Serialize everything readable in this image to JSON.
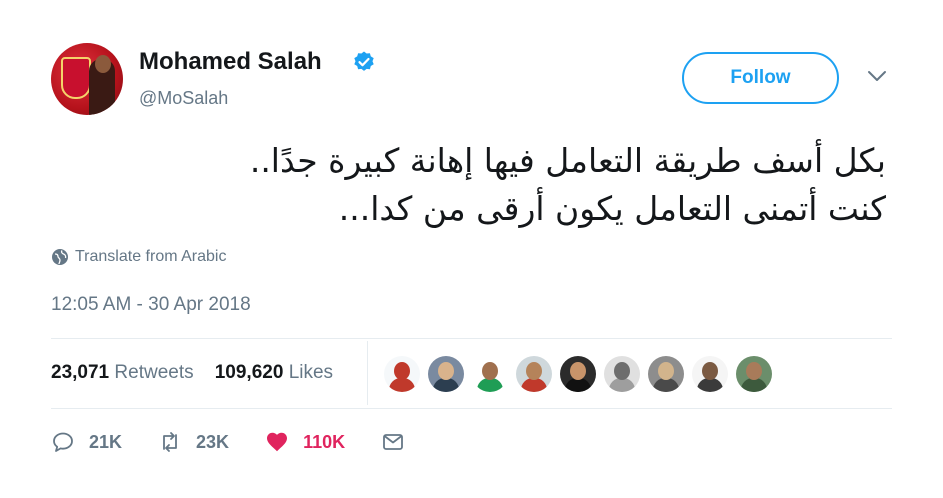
{
  "user": {
    "display_name": "Mohamed Salah",
    "handle": "@MoSalah",
    "verified": true,
    "avatar_icon": "liverpool-avatar"
  },
  "follow_label": "Follow",
  "tweet": {
    "lines": [
      "بكل أسف طريقة التعامل فيها إهانة كبيرة جدًا..",
      "كنت أتمنى التعامل يكون أرقى من كدا..."
    ],
    "translate_label": "Translate from Arabic",
    "timestamp": "12:05 AM - 30 Apr 2018"
  },
  "stats": {
    "retweets_count": "23,071",
    "retweets_label": "Retweets",
    "likes_count": "109,620",
    "likes_label": "Likes"
  },
  "likers": [
    {
      "icon": "liker-avatar-1",
      "bg": "#f5f8fa",
      "face": "#c0392b",
      "body": "#c0392b"
    },
    {
      "icon": "liker-avatar-2",
      "bg": "#7a8aa0",
      "face": "#d9b38c",
      "body": "#2c3e50"
    },
    {
      "icon": "liker-avatar-3",
      "bg": "#ffffff",
      "face": "#a0704e",
      "body": "#1f9d55"
    },
    {
      "icon": "liker-avatar-4",
      "bg": "#cfd8dc",
      "face": "#b5835a",
      "body": "#c0392b"
    },
    {
      "icon": "liker-avatar-5",
      "bg": "#2b2b2b",
      "face": "#c8946a",
      "body": "#111111"
    },
    {
      "icon": "liker-avatar-6",
      "bg": "#e0e0e0",
      "face": "#6d6d6d",
      "body": "#9e9e9e"
    },
    {
      "icon": "liker-avatar-7",
      "bg": "#8d8d8d",
      "face": "#d2b48c",
      "body": "#4a4a4a"
    },
    {
      "icon": "liker-avatar-8",
      "bg": "#f5f5f5",
      "face": "#7b5a42",
      "body": "#3b3b3b"
    },
    {
      "icon": "liker-avatar-9",
      "bg": "#6b8e6b",
      "face": "#a87b5a",
      "body": "#3d5a3d"
    }
  ],
  "actions": {
    "reply_count": "21K",
    "retweet_count": "23K",
    "like_count": "110K"
  },
  "colors": {
    "accent": "#1da1f2",
    "like": "#e0245e",
    "muted": "#657786"
  }
}
